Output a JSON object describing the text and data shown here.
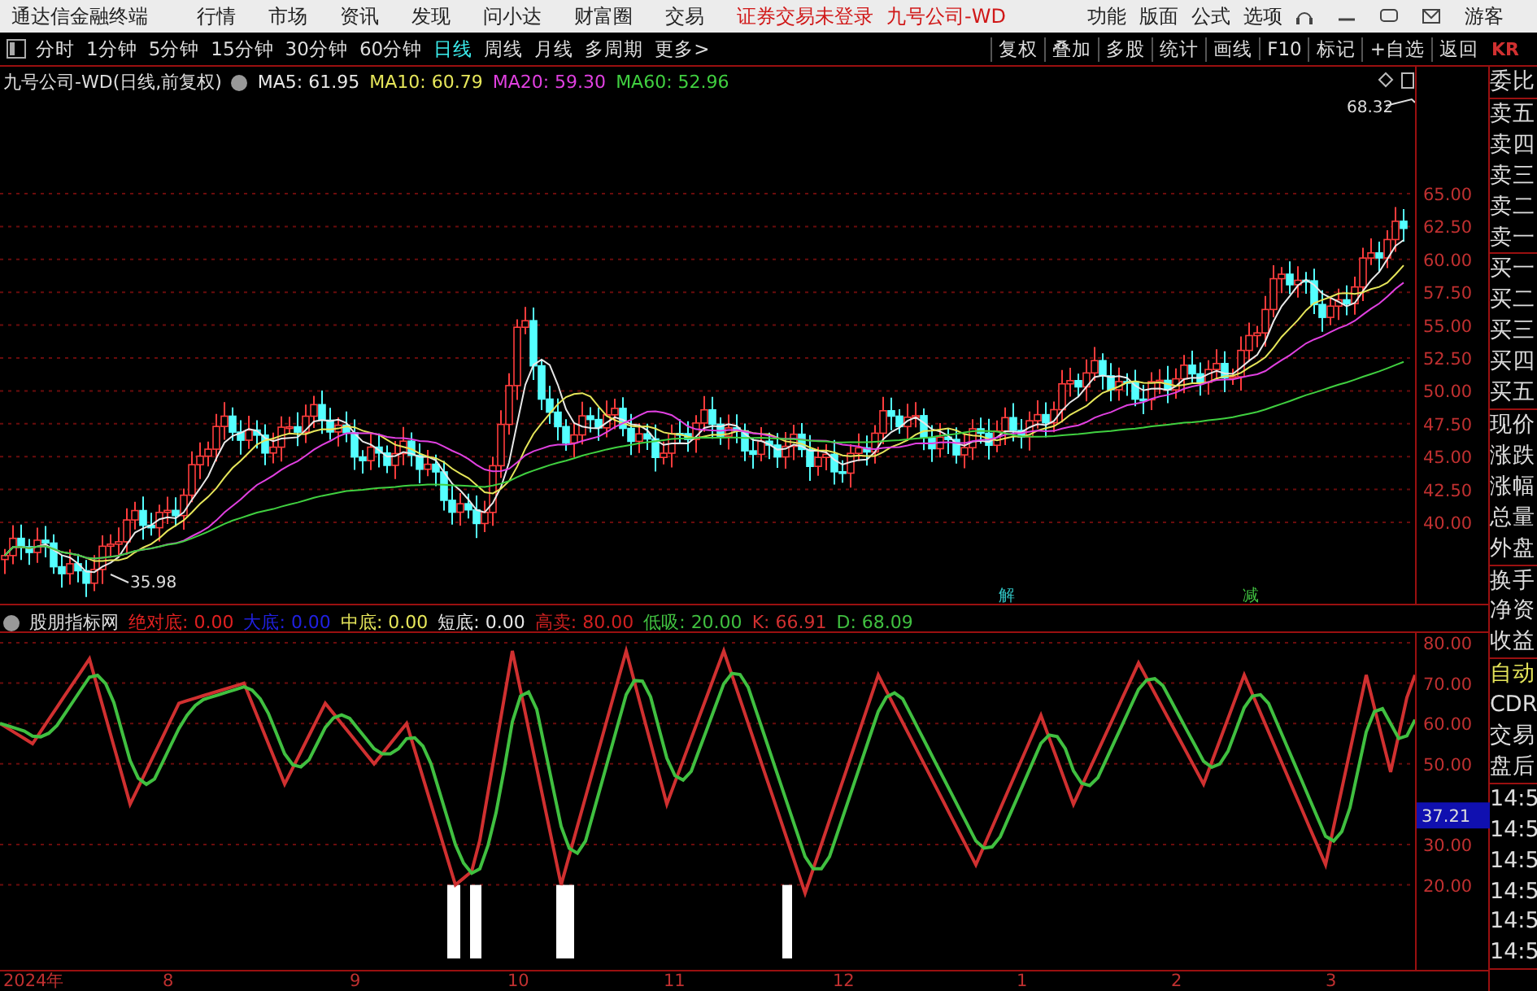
{
  "menu_bar": {
    "app_name": "通达信金融终端",
    "items": [
      "行情",
      "市场",
      "资讯",
      "发现",
      "问小达",
      "财富圈",
      "交易"
    ],
    "status": "证券交易未登录",
    "stock": "九号公司-WD",
    "right_items": [
      "功能",
      "版面",
      "公式",
      "选项"
    ],
    "user": "游客"
  },
  "toolbar": {
    "periods": [
      {
        "label": "分时",
        "selected": false
      },
      {
        "label": "1分钟",
        "selected": false
      },
      {
        "label": "5分钟",
        "selected": false
      },
      {
        "label": "15分钟",
        "selected": false
      },
      {
        "label": "30分钟",
        "selected": false
      },
      {
        "label": "60分钟",
        "selected": false
      },
      {
        "label": "日线",
        "selected": true
      },
      {
        "label": "周线",
        "selected": false
      },
      {
        "label": "月线",
        "selected": false
      },
      {
        "label": "多周期",
        "selected": false
      },
      {
        "label": "更多>",
        "selected": false
      }
    ],
    "actions": [
      "复权",
      "叠加",
      "多股",
      "统计",
      "画线",
      "F10",
      "标记",
      "+自选",
      "返回"
    ],
    "corner": "KR"
  },
  "main_chart": {
    "title": "九号公司-WD(日线,前复权)",
    "averages": [
      {
        "label": "MA5: 61.95",
        "color": "#e8e8e8"
      },
      {
        "label": "MA10: 60.79",
        "color": "#e6e65a"
      },
      {
        "label": "MA20: 59.30",
        "color": "#e040e0"
      },
      {
        "label": "MA60: 52.96",
        "color": "#40d040"
      }
    ],
    "high_label": "68.32",
    "low_label": "35.98",
    "markers": [
      {
        "text": "解",
        "color": "#30c0c0"
      },
      {
        "text": "减",
        "color": "#40c040"
      }
    ],
    "price_ticks": [
      "65.00",
      "62.50",
      "60.00",
      "57.50",
      "55.00",
      "52.50",
      "50.00",
      "47.50",
      "45.00",
      "42.50",
      "40.00"
    ]
  },
  "indicator": {
    "title": "股朋指标网",
    "lines": [
      {
        "label": "绝对底:",
        "value": "0.00",
        "color": "#e02020"
      },
      {
        "label": "大底:",
        "value": "0.00",
        "color": "#2020e0"
      },
      {
        "label": "中底:",
        "value": "0.00",
        "color": "#e6e65a"
      },
      {
        "label": "短底:",
        "value": "0.00",
        "color": "#e8e8e8"
      },
      {
        "label": "高卖:",
        "value": "80.00",
        "color": "#d02020"
      },
      {
        "label": "低吸:",
        "value": "20.00",
        "color": "#40c040"
      },
      {
        "label": "K:",
        "value": "66.91",
        "color": "#d03030"
      },
      {
        "label": "D:",
        "value": "68.09",
        "color": "#40c040"
      }
    ],
    "ticks": [
      "80.00",
      "70.00",
      "60.00",
      "50.00",
      "30.00",
      "20.00"
    ],
    "cursor_value": "37.21"
  },
  "time_axis": [
    "2024年",
    "8",
    "9",
    "10",
    "11",
    "12",
    "1",
    "2",
    "3"
  ],
  "side_panel": {
    "groups": [
      [
        "委比"
      ],
      [
        "卖五",
        "卖四",
        "卖三",
        "卖二",
        "卖一"
      ],
      [
        "买一",
        "买二",
        "买三",
        "买四",
        "买五"
      ],
      [
        "现价",
        "涨跌",
        "涨幅",
        "总量",
        "外盘"
      ],
      [
        "换手",
        "净资",
        "收益"
      ],
      [
        "自动",
        "CDR",
        "交易",
        "盘后"
      ],
      [
        "14:5",
        "14:5",
        "14:5",
        "14:5",
        "14:5",
        "14:5"
      ]
    ],
    "auto_on": true
  }
}
